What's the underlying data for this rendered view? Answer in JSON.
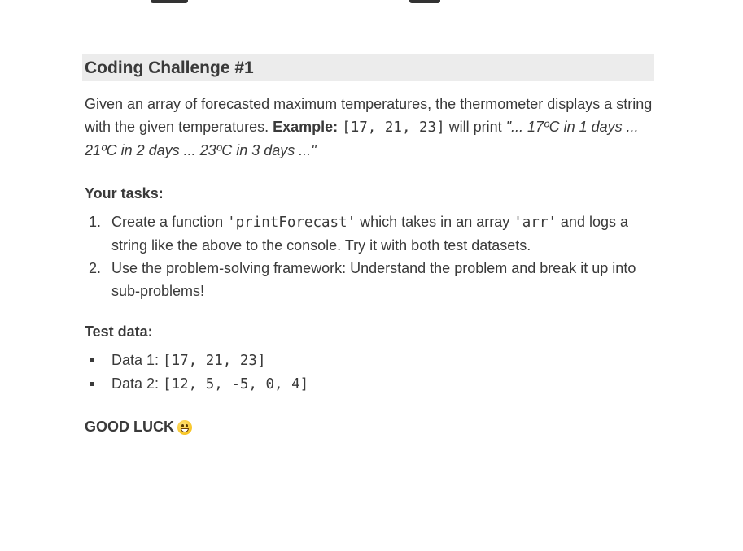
{
  "heading": "Coding Challenge #1",
  "intro": {
    "text1": "Given an array of forecasted maximum temperatures, the thermometer displays a string with the given temperatures. ",
    "example_label": "Example:",
    "example_code": "[17, 21, 23]",
    "text2": " will print ",
    "example_output": "\"... 17ºC in 1 days ... 21ºC in 2 days ... 23ºC in 3 days ...\""
  },
  "tasks": {
    "heading": "Your tasks:",
    "items": [
      {
        "number": "1.",
        "part1": "Create a function ",
        "code1": "'printForecast'",
        "part2": " which takes in an array ",
        "code2": "'arr'",
        "part3": " and logs a string like the above to the console. Try it with both test datasets."
      },
      {
        "number": "2.",
        "text": "Use the problem-solving framework: Understand the problem and break it up into sub-problems!"
      }
    ]
  },
  "test_data": {
    "heading": "Test data:",
    "items": [
      {
        "label": "Data 1: ",
        "value": "[17, 21, 23]"
      },
      {
        "label": "Data 2: ",
        "value": "[12, 5, -5, 0, 4]"
      }
    ]
  },
  "footer": {
    "text": "GOOD LUCK",
    "icon": "grinning-face-icon"
  }
}
